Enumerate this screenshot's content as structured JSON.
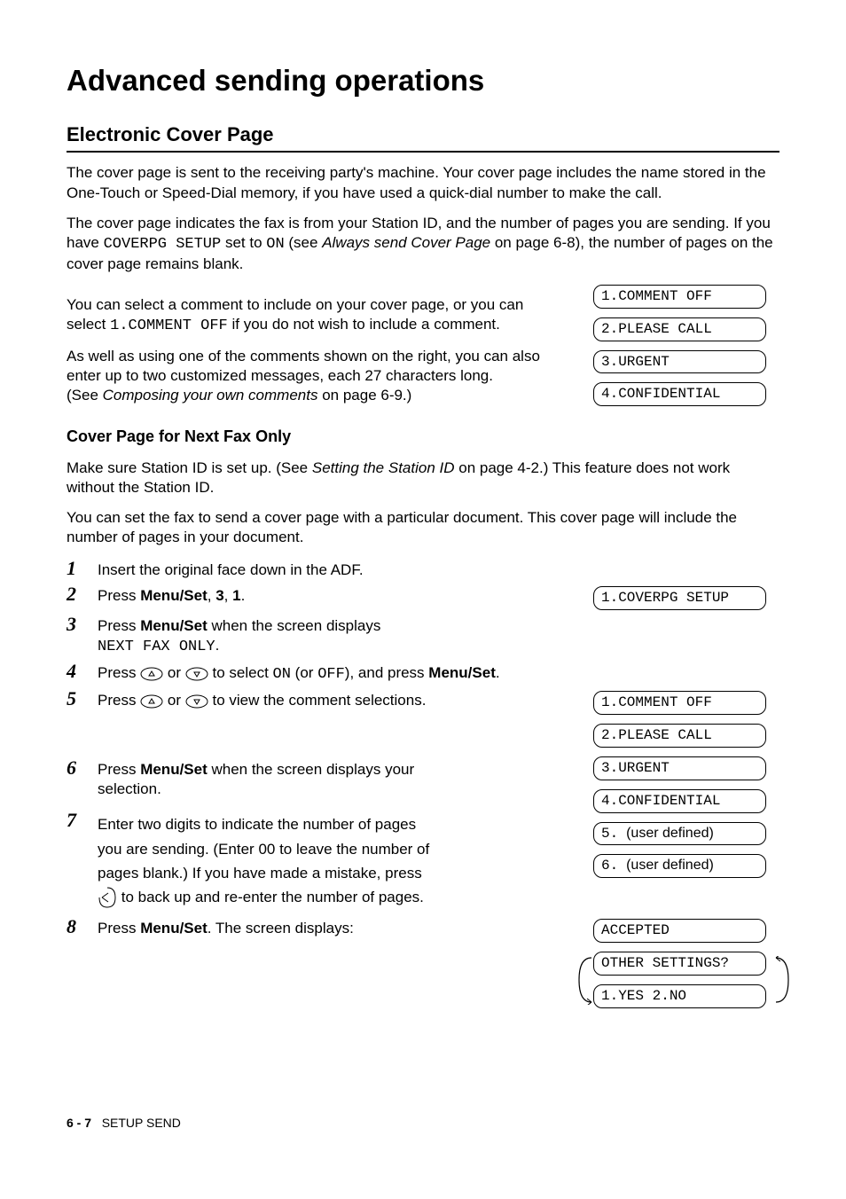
{
  "title": "Advanced sending operations",
  "section1": {
    "heading": "Electronic Cover Page",
    "para1": "The cover page is sent to the receiving party's machine. Your cover page includes the name stored in the One-Touch or Speed-Dial memory, if you have used a quick-dial number to make the call.",
    "para2_a": "The cover page indicates the fax is from your Station ID, and the number of pages you are sending. If you have ",
    "para2_mono1": "COVERPG SETUP",
    "para2_b": " set to ",
    "para2_mono2": "ON",
    "para2_c": " (see ",
    "para2_italic": "Always send Cover Page",
    "para2_d": " on page 6-8), the number of pages on the cover page remains blank.",
    "para3_a": "You can select a comment to include on your cover page, or you can select ",
    "para3_mono": "1.COMMENT OFF",
    "para3_b": " if you do not wish to include a comment.",
    "para4": "As well as using one of the comments shown on the right, you can also enter up to two customized messages, each 27 characters long.",
    "para4_see_a": "(See ",
    "para4_see_italic": "Composing your own comments",
    "para4_see_b": " on page 6-9.)",
    "lcd1": "1.COMMENT OFF",
    "lcd2": "2.PLEASE CALL",
    "lcd3": "3.URGENT",
    "lcd4": "4.CONFIDENTIAL"
  },
  "section2": {
    "heading": "Cover Page for Next Fax Only",
    "para1_a": "Make sure Station ID is set up. (See ",
    "para1_italic": "Setting the Station ID",
    "para1_b": " on page 4-2.) This feature does not work without the Station ID.",
    "para2": "You can set the fax to send a cover page with a particular document. This cover page will include the number of pages in your document.",
    "steps": {
      "s1": "Insert the original face down in the ADF.",
      "s2_a": "Press ",
      "s2_b": "Menu/Set",
      "s2_c": ", ",
      "s2_d": "3",
      "s2_e": ", ",
      "s2_f": "1",
      "s2_g": ".",
      "s2_lcd": "1.COVERPG SETUP",
      "s3_a": "Press ",
      "s3_b": "Menu/Set",
      "s3_c": " when the screen displays ",
      "s3_mono": "NEXT FAX ONLY",
      "s3_d": ".",
      "s4_a": "Press ",
      "s4_b": " or ",
      "s4_c": " to select ",
      "s4_mono1": "ON",
      "s4_d": " (or ",
      "s4_mono2": "OFF",
      "s4_e": "), and press ",
      "s4_bold": "Menu/Set",
      "s4_f": ".",
      "s5_a": "Press ",
      "s5_b": " or ",
      "s5_c": " to view the comment selections.",
      "s5_lcd1": "1.COMMENT OFF",
      "s5_lcd2": "2.PLEASE CALL",
      "s5_lcd3": "3.URGENT",
      "s5_lcd4": "4.CONFIDENTIAL",
      "s5_lcd5": "5.  (user defined)",
      "s5_lcd6": "6.  (user defined)",
      "s6_a": "Press ",
      "s6_b": "Menu/Set",
      "s6_c": " when the screen displays your selection.",
      "s7_a": "Enter two digits to indicate the number of pages you are sending. (Enter 00 to leave the number of pages blank.) If you have made a mistake, press ",
      "s7_b": " to back up and re-enter the number of pages.",
      "s8_a": "Press ",
      "s8_b": "Menu/Set",
      "s8_c": ". The screen displays:",
      "s8_lcd1": "ACCEPTED",
      "s8_lcd2": "OTHER SETTINGS?",
      "s8_lcd3": "1.YES 2.NO"
    }
  },
  "footer": {
    "page": "6 - 7",
    "label": "SETUP SEND"
  }
}
